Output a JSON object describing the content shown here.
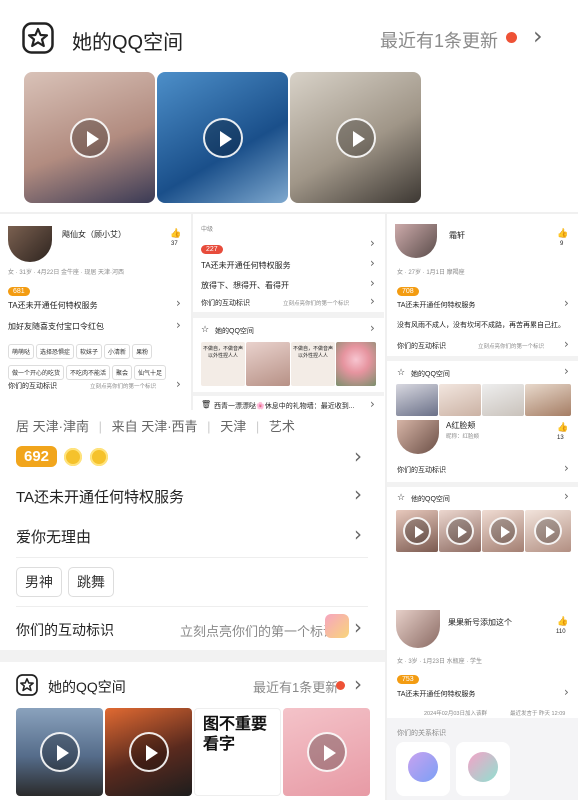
{
  "header": {
    "title": "她的QQ空间",
    "update_text": "最近有1条更新"
  },
  "left_card": {
    "nickname": "飚仙女（顾小艾）",
    "like_count": "37",
    "info": "女 · 31岁 · 4月22日 金牛座 · 现居 天津·河西",
    "level": "681",
    "privilege": "TA还未开通任何特权服务",
    "signature": "加好友随喜支付宝口令红包",
    "tags_row1": [
      "萌萌哒",
      "选择恐惧症",
      "软妹子",
      "小清新",
      "果粉"
    ],
    "tags_row2": [
      "做一个开心的吃货",
      "不吃肉不能活",
      "聚会",
      "仙气十足"
    ],
    "interaction": "你们的互动标识",
    "interaction_hint": "立刻点亮你们的第一个标识"
  },
  "mid_card": {
    "top_label": "中级",
    "level": "227",
    "privilege": "TA还未开通任何特权服务",
    "signature": "放得下、想得开、看得开",
    "interaction": "你们的互动标识",
    "interaction_hint": "立刻点亮你们的第一个标识",
    "space_title": "她的QQ空间",
    "meme1": "不做自，不做音声 以外性捏人人",
    "meme2": "不做自，不做音声 以外性捏人人",
    "post": "西青一漂漂哒🌸休息中的礼物墙：最近收到..."
  },
  "right_card": {
    "nickname": "霜轩",
    "like_count": "9",
    "info": "女 · 27岁 · 1月1日 摩羯座",
    "level": "708",
    "privilege": "TA还未开通任何特权服务",
    "signature": "没有风雨不成人，没有坎坷不成路，再苦再累自己扛。",
    "interaction": "你们的互动标识",
    "interaction_hint": "立刻点亮你们的第一个标识",
    "space_title": "她的QQ空间"
  },
  "right_card2": {
    "nickname": "A红脸颊",
    "sub": "昵称：红脸颊",
    "like_count": "13",
    "interaction": "你们的互动标识",
    "space_title": "他的QQ空间"
  },
  "right_card3": {
    "nickname": "果果新号添加这个",
    "like_count": "110",
    "info": "女 · 3岁 · 1月23日 水瓶座 · 学生",
    "level": "753",
    "privilege": "TA还未开通任何特权服务",
    "joined": "2024年02月03日加入该群",
    "last_speak": "最近发言于 昨天 12:09",
    "relation_title": "你们的关系标识"
  },
  "main": {
    "location_parts": [
      "居 天津·津南",
      "来自 天津·西青",
      "天津",
      "艺术"
    ],
    "score": "692",
    "privilege": "TA还未开通任何特权服务",
    "signature": "爱你无理由",
    "tags": [
      "男神",
      "跳舞"
    ],
    "interaction": "你们的互动标识",
    "interaction_hint": "立刻点亮你们的第一个标识",
    "space_title": "她的QQ空间",
    "update_text": "最近有1条更新",
    "meme_text": "图不重要 看字"
  }
}
